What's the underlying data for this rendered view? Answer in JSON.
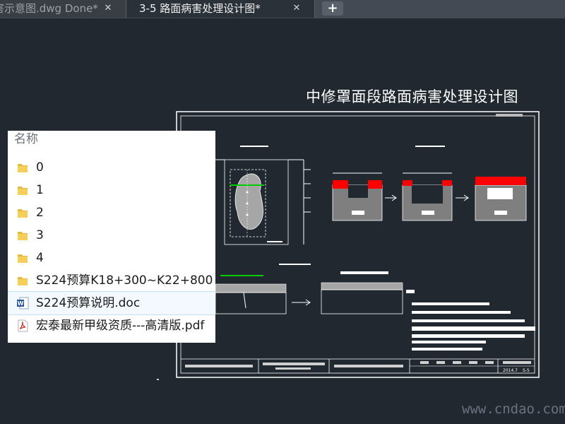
{
  "tabs": [
    {
      "label": "病害示意图.dwg Done*",
      "close_icon": "close-icon",
      "active": false
    },
    {
      "label": "3-5 路面病害处理设计图*",
      "close_icon": "close-icon",
      "active": true
    }
  ],
  "new_tab_symbol": "+",
  "drawing": {
    "title": "中修罩面段路面病害处理设计图"
  },
  "explorer": {
    "column_header": "名称",
    "items": [
      {
        "name": "0",
        "icon": "folder-icon"
      },
      {
        "name": "1",
        "icon": "folder-icon"
      },
      {
        "name": "2",
        "icon": "folder-icon"
      },
      {
        "name": "3",
        "icon": "folder-icon"
      },
      {
        "name": "4",
        "icon": "folder-icon"
      },
      {
        "name": "S224预算K18+300~K22+800",
        "icon": "folder-icon"
      },
      {
        "name": "S224预算说明.doc",
        "icon": "word-doc-icon",
        "selected": true
      },
      {
        "name": "宏泰最新甲级资质---高清版.pdf",
        "icon": "pdf-icon"
      }
    ]
  },
  "title_block": {
    "revision": "2014.7",
    "drawing_no": "S-5"
  },
  "watermark": "www.cndao.com",
  "colors": {
    "canvas_bg": "#212830",
    "tab_active": "#2b3139",
    "cad_red": "#ff0000",
    "cad_line": "#ffffff"
  }
}
